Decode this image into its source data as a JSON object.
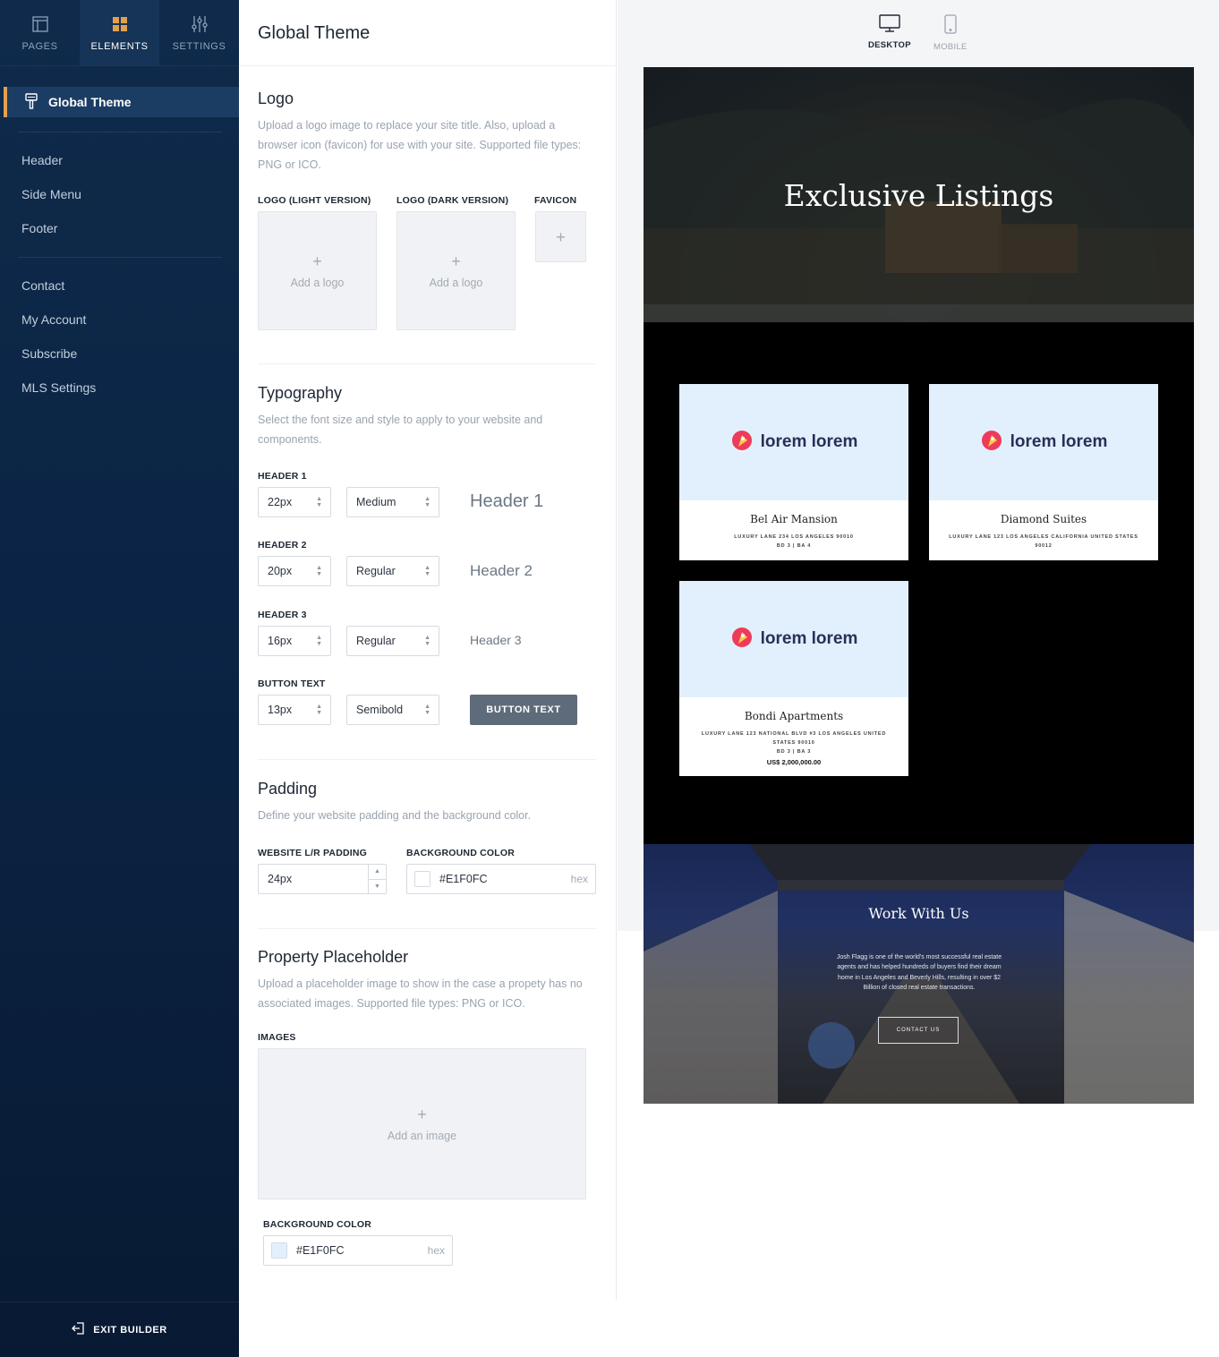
{
  "sidebar": {
    "tabs": [
      {
        "label": "PAGES",
        "icon": "pages-icon"
      },
      {
        "label": "ELEMENTS",
        "icon": "elements-icon",
        "active": true
      },
      {
        "label": "SETTINGS",
        "icon": "settings-icon"
      }
    ],
    "active_item": {
      "label": "Global Theme",
      "icon": "paint-brush-icon"
    },
    "group1": [
      "Header",
      "Side Menu",
      "Footer"
    ],
    "group2": [
      "Contact",
      "My Account",
      "Subscribe",
      "MLS Settings"
    ],
    "exit_label": "EXIT BUILDER",
    "accent_color": "#e3a04f"
  },
  "panel": {
    "title": "Global Theme",
    "logo": {
      "title": "Logo",
      "desc": "Upload a logo image to replace your site title. Also, upload a browser icon (favicon) for use with your site. Supported file types: PNG or ICO.",
      "light_label": "LOGO (LIGHT VERSION)",
      "dark_label": "LOGO (DARK VERSION)",
      "favicon_label": "FAVICON",
      "add_logo": "Add a logo",
      "plus": "+"
    },
    "typography": {
      "title": "Typography",
      "desc": "Select the font size and style to apply to your website and components.",
      "rows": [
        {
          "label": "HEADER 1",
          "size": "22px",
          "weight": "Medium",
          "preview": "Header 1"
        },
        {
          "label": "HEADER 2",
          "size": "20px",
          "weight": "Regular",
          "preview": "Header 2"
        },
        {
          "label": "HEADER 3",
          "size": "16px",
          "weight": "Regular",
          "preview": "Header 3"
        },
        {
          "label": "BUTTON TEXT",
          "size": "13px",
          "weight": "Semibold",
          "preview": "BUTTON TEXT"
        }
      ]
    },
    "padding": {
      "title": "Padding",
      "desc": "Define your website padding and the background color.",
      "padding_label": "WEBSITE L/R PADDING",
      "padding_value": "24px",
      "bg_label": "BACKGROUND COLOR",
      "bg_value": "#E1F0FC",
      "hex": "hex"
    },
    "placeholder": {
      "title": "Property Placeholder",
      "desc": "Upload a placeholder image to show in the case a propety has no associated images. Supported file types: PNG or ICO.",
      "images_label": "IMAGES",
      "add_image": "Add an image",
      "bg_label": "BACKGROUND COLOR",
      "bg_value": "#E1F0FC",
      "hex": "hex",
      "swatch_color": "#e1f0fc"
    }
  },
  "preview": {
    "devices": [
      {
        "label": "DESKTOP",
        "icon": "desktop-icon",
        "active": true
      },
      {
        "label": "MOBILE",
        "icon": "mobile-icon"
      }
    ],
    "hero_title": "Exclusive Listings",
    "cards": [
      {
        "logo_text": "lorem lorem",
        "name": "Bel Air Mansion",
        "address": "LUXURY LANE 234 LOS ANGELES 90010",
        "meta": "BD 3 | BA 4",
        "price": ""
      },
      {
        "logo_text": "lorem lorem",
        "name": "Diamond Suites",
        "address": "LUXURY LANE 123 LOS ANGELES CALIFORNIA UNITED STATES 90012",
        "meta": "",
        "price": ""
      },
      {
        "logo_text": "lorem lorem",
        "name": "Bondi Apartments",
        "address": "LUXURY LANE 123 NATIONAL BLVD #3 LOS ANGELES UNITED STATES 90010",
        "meta": "BD 3 | BA 3",
        "price": "US$ 2,000,000.00"
      }
    ],
    "work_title": "Work With Us",
    "work_text": "Josh Flagg is one of the world's most successful real estate agents and has helped hundreds of buyers find their dream home in Los Angeles and Beverly Hills, resulting in over $2 Billion of closed real estate transactions.",
    "work_button": "CONTACT US",
    "card_bg_color": "#e1f0fc"
  }
}
